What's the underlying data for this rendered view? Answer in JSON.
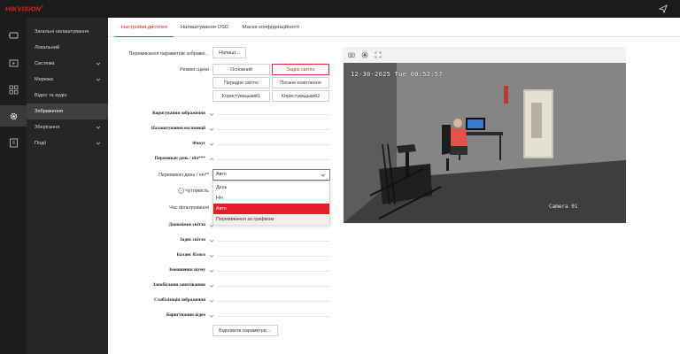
{
  "brand": {
    "logo_text": "HIKVISION",
    "logo_mark": "®",
    "accent": "#e32028"
  },
  "sidebar": {
    "items": [
      {
        "label": "Загальні налаштування"
      },
      {
        "label": "Локальний"
      },
      {
        "label": "Система"
      },
      {
        "label": "Мережа"
      },
      {
        "label": "Відео та аудіо"
      },
      {
        "label": "Зображення"
      },
      {
        "label": "Зберігання"
      },
      {
        "label": "Події"
      }
    ]
  },
  "tabs": [
    {
      "label": "Настройки дисплея"
    },
    {
      "label": "Налаштування OSD"
    },
    {
      "label": "Маска конфіденційності"
    }
  ],
  "form": {
    "switch_label": "Перемикання параметрів зображе...",
    "switch_button": "Налашт...",
    "scene_label": "Режим сцени",
    "scene_options": [
      "Основний",
      "Заднє світло",
      "Передне світло",
      "Погане освітлення",
      "Користувацький1",
      "Користувацький2"
    ],
    "sections": [
      "Коригування зображення",
      "Налаштування експозиції",
      "Фокус",
      "Перемикач день / ніч***"
    ],
    "daynight_label": "Перемикач день / ніч**",
    "daynight_value": "Авто",
    "daynight_options": [
      "День",
      "Ніч",
      "Авто",
      "Перемикання за графіком"
    ],
    "sensitivity_label": "Чутливість",
    "filter_label": "Час фільтрування",
    "sections2": [
      "Допоміжне світло",
      "Заднє світло",
      "Баланс білого",
      "Зменшення шуму",
      "Запобігання запотіванню",
      "Стабілізація зображення",
      "Коригування відео"
    ],
    "restore_button": "Відновити параметри ..."
  },
  "preview": {
    "timestamp": "12-30-2025 Tue 00:52:57",
    "camera_name": "Camera 01"
  }
}
